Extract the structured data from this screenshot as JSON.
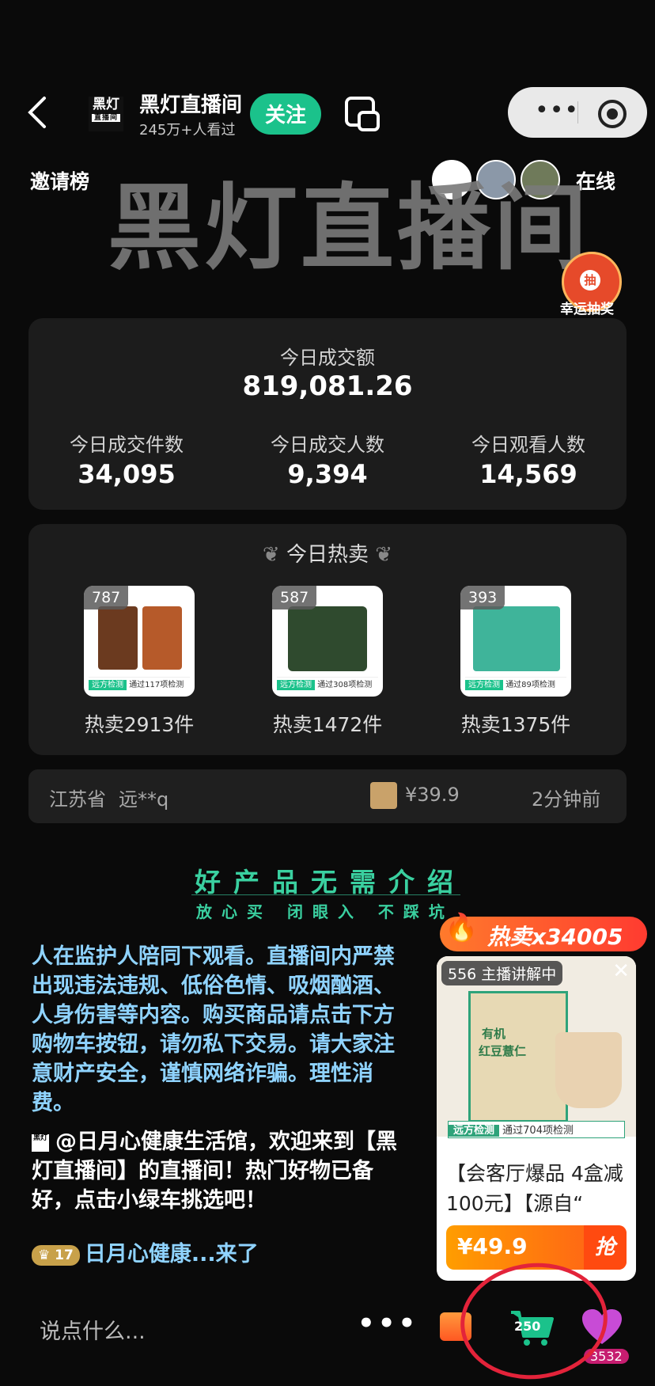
{
  "header": {
    "room_name": "黑灯直播间",
    "viewers": "245万+人看过",
    "follow_label": "关注",
    "logo_text": "黑灯",
    "logo_sub": "直播间"
  },
  "top_row": {
    "invite_label": "邀请榜",
    "online_label": "在线",
    "lottery_icon": "抽",
    "lottery_label": "幸运抽奖"
  },
  "banner": "黑灯直播间",
  "stats": {
    "gmv_label": "今日成交额",
    "gmv_value": "819,081.26",
    "items": [
      {
        "label": "今日成交件数",
        "value": "34,095"
      },
      {
        "label": "今日成交人数",
        "value": "9,394"
      },
      {
        "label": "今日观看人数",
        "value": "14,569"
      }
    ]
  },
  "hot": {
    "title": "今日热卖",
    "products": [
      {
        "count": "787",
        "sold": "热卖2913件",
        "tag": "远方检测",
        "check": "通过117项检测"
      },
      {
        "count": "587",
        "sold": "热卖1472件",
        "tag": "远方检测",
        "check": "通过308项检测"
      },
      {
        "count": "393",
        "sold": "热卖1375件",
        "tag": "远方检测",
        "check": "通过89项检测"
      }
    ]
  },
  "ticker": {
    "location": "江苏省",
    "user": "远**q",
    "price": "¥39.9",
    "time": "2分钟前"
  },
  "slogan": {
    "main": "好产品无需介绍",
    "sub": "放心买 闭眼入 不踩坑"
  },
  "chat": {
    "notice": "人在监护人陪同下观看。直播间内严禁出现违法违规、低俗色情、吸烟酗酒、人身伤害等内容。购买商品请点击下方购物车按钮，请勿私下交易。请大家注意财产安全，谨慎网络诈骗。理性消费。",
    "welcome": "@日月心健康生活馆，欢迎来到【黑灯直播间】的直播间！热门好物已备好，点击小绿车挑选吧！",
    "level": "17",
    "joined": "日月心健康...来了"
  },
  "featured": {
    "hot_badge": "热卖x34005",
    "live_label": "556 主播讲解中",
    "img_line1": "有机",
    "img_line2": "红豆薏仁",
    "tag": "远方检测",
    "check": "通过704项检测",
    "desc": "【会客厅爆品 4盒减100元】【源自“",
    "price": "¥49.9",
    "grab": "抢"
  },
  "bottom": {
    "input_placeholder": "说点什么...",
    "cart_count": "250",
    "like_count": "3532"
  },
  "colors": {
    "accent": "#1bc28b",
    "panel": "#1c1c1c",
    "highlight_ring": "#e3233a"
  }
}
